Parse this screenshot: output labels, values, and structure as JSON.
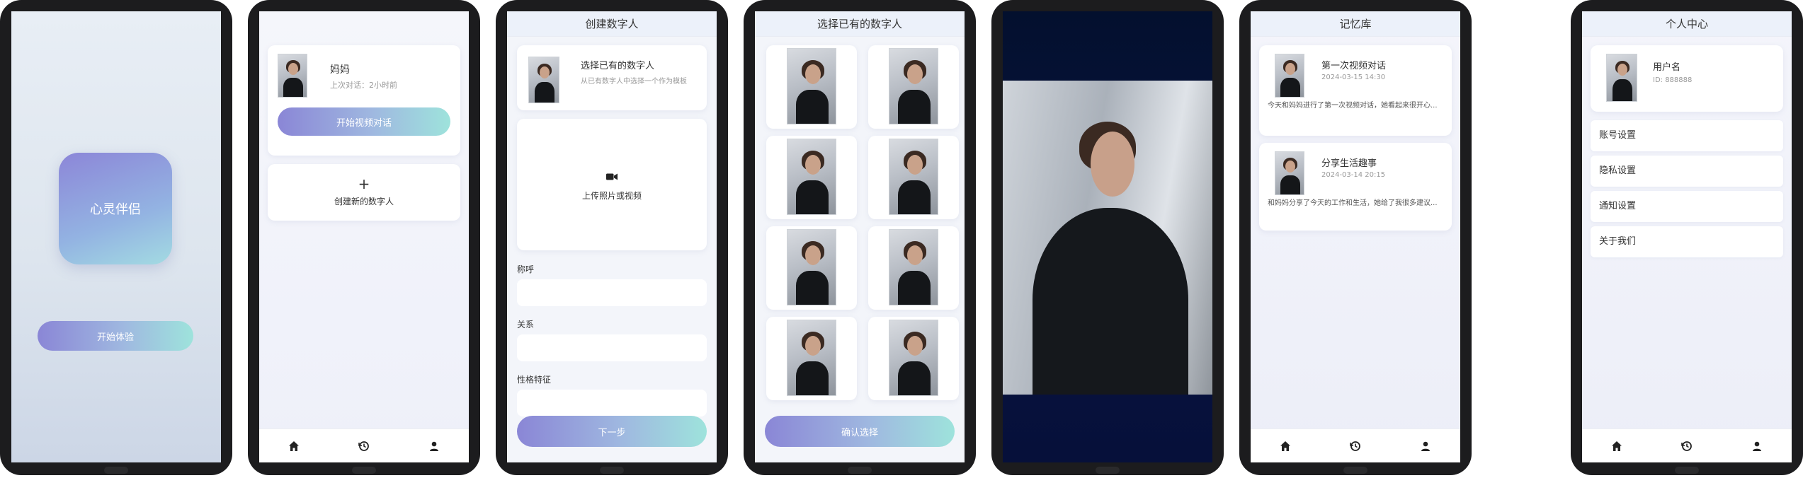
{
  "splash": {
    "title": "心灵伴侣",
    "start_label": "开始体验"
  },
  "home": {
    "persona_name": "妈妈",
    "last_chat": "上次对话：2小时前",
    "video_button": "开始视频对话",
    "create_plus": "+",
    "create_label": "创建新的数字人"
  },
  "create": {
    "title": "创建数字人",
    "choose_existing_title": "选择已有的数字人",
    "choose_existing_desc": "从已有数字人中选择一个作为模板",
    "upload_label": "上传照片或视频",
    "field_nickname": "称呼",
    "field_relation": "关系",
    "field_personality": "性格特征",
    "next_button": "下一步"
  },
  "select": {
    "title": "选择已有的数字人",
    "confirm_button": "确认选择"
  },
  "memory": {
    "title": "记忆库",
    "items": [
      {
        "title": "第一次视频对话",
        "time": "2024-03-15 14:30",
        "text": "今天和妈妈进行了第一次视频对话，她看起来很开心..."
      },
      {
        "title": "分享生活趣事",
        "time": "2024-03-14 20:15",
        "text": "和妈妈分享了今天的工作和生活，她给了我很多建议..."
      }
    ]
  },
  "profile": {
    "title": "个人中心",
    "username": "用户名",
    "user_id": "ID: 888888",
    "menu": [
      "账号设置",
      "隐私设置",
      "通知设置",
      "关于我们"
    ]
  },
  "colors": {
    "accent_start": "#8a86d6",
    "accent_end": "#9ee3dc",
    "phone_frame": "#1c1c1e",
    "video_bg": "#0a1440"
  },
  "icons": [
    "home-icon",
    "history-icon",
    "user-icon",
    "video-camera-icon"
  ]
}
